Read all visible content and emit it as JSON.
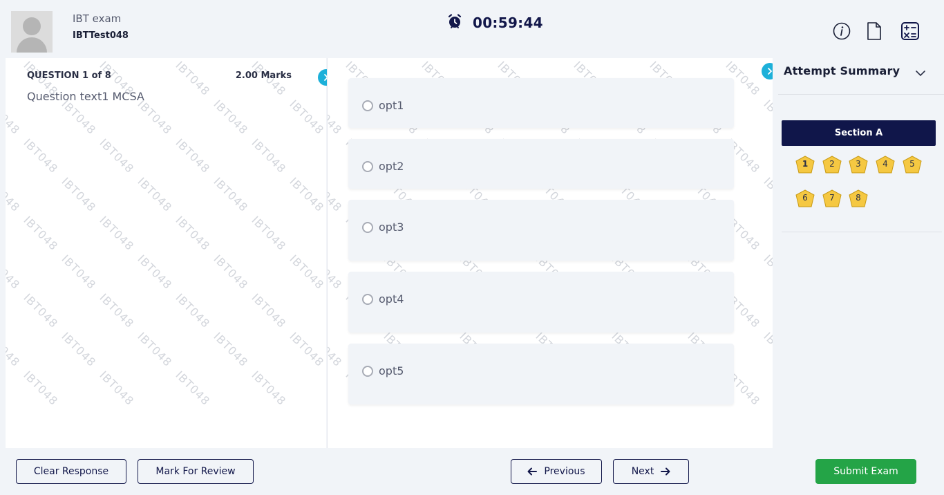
{
  "header": {
    "exam_name": "IBT exam",
    "user_id": "IBTTest048",
    "timer": "00:59:44",
    "icons": [
      "alarm-clock-icon",
      "info-icon",
      "document-icon",
      "calculator-icon"
    ]
  },
  "question": {
    "number_label": "QUESTION 1 of 8",
    "marks": "2.00 Marks",
    "text": "Question text1 MCSA",
    "options": [
      "opt1",
      "opt2",
      "opt3",
      "opt4",
      "opt5"
    ]
  },
  "watermark_text": "IBT048",
  "summary": {
    "title": "Attempt Summary",
    "section_label": "Section A",
    "questions": [
      "1",
      "2",
      "3",
      "4",
      "5",
      "6",
      "7",
      "8"
    ],
    "badge_color": "#f5c842",
    "badge_border": "#c89a14"
  },
  "footer": {
    "clear_label": "Clear Response",
    "review_label": "Mark For Review",
    "previous_label": "Previous",
    "next_label": "Next",
    "submit_label": "Submit Exam"
  },
  "colors": {
    "primary_navy": "#12174a",
    "accent_cyan": "#1db0d9",
    "submit_green": "#24a447"
  }
}
